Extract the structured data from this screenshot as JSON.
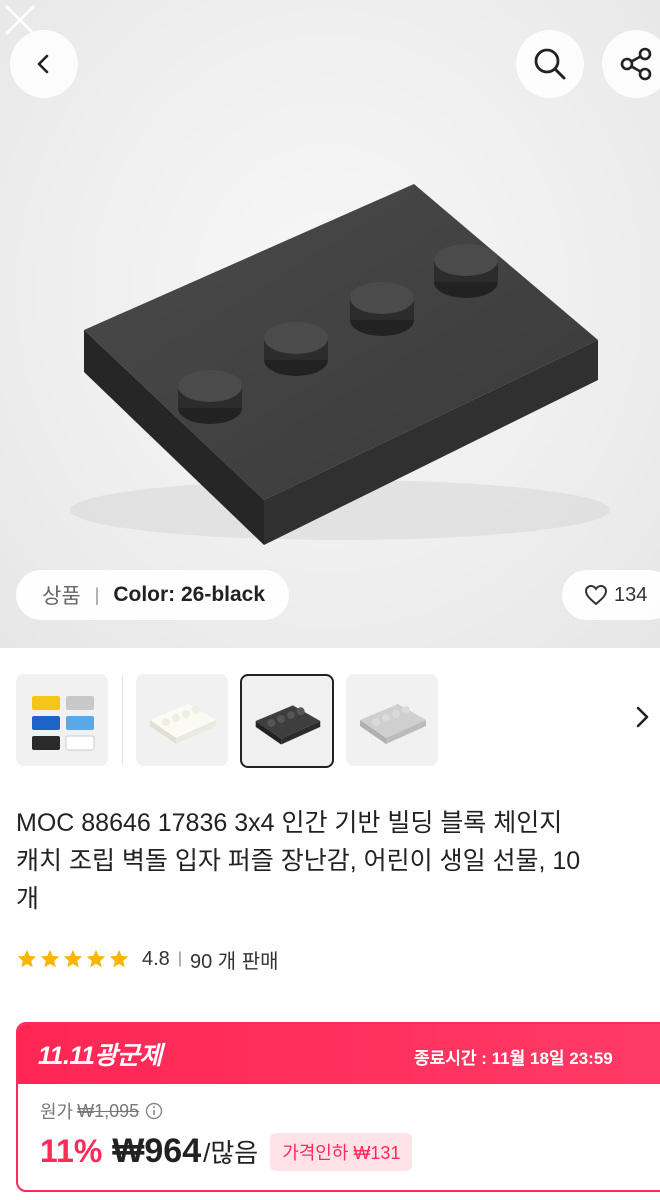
{
  "header": {
    "back_icon": "chevron-left-icon",
    "search_icon": "search-icon",
    "share_icon": "share-icon"
  },
  "variant": {
    "label": "상품",
    "value": "Color: 26-black"
  },
  "likes": {
    "icon": "heart-icon",
    "count": "134"
  },
  "thumbnails": [
    {
      "name": "multicolor-set"
    },
    {
      "name": "white-plate"
    },
    {
      "name": "black-plate",
      "selected": true
    },
    {
      "name": "gray-plate"
    }
  ],
  "product": {
    "title_line1": "MOC 88646 17836 3x4 인간 기반 빌딩 블록 체인지",
    "title_line2": "캐치 조립 벽돌 입자 퍼즐 장난감, 어린이 생일 선물, 10",
    "title_line3": "개",
    "rating": "4.8",
    "sold": "90 개 판매"
  },
  "deal": {
    "brand": "11.11광군제",
    "ends_label": "종료시간 :  11월 18일 23:59",
    "original_label": "원가",
    "original_price": "₩1,095",
    "discount": "11%",
    "price": "₩964",
    "unit": "/많음",
    "price_cut": "가격인하 ₩131"
  },
  "colors": {
    "accent": "#ff2a5a",
    "star": "#ffb400"
  }
}
